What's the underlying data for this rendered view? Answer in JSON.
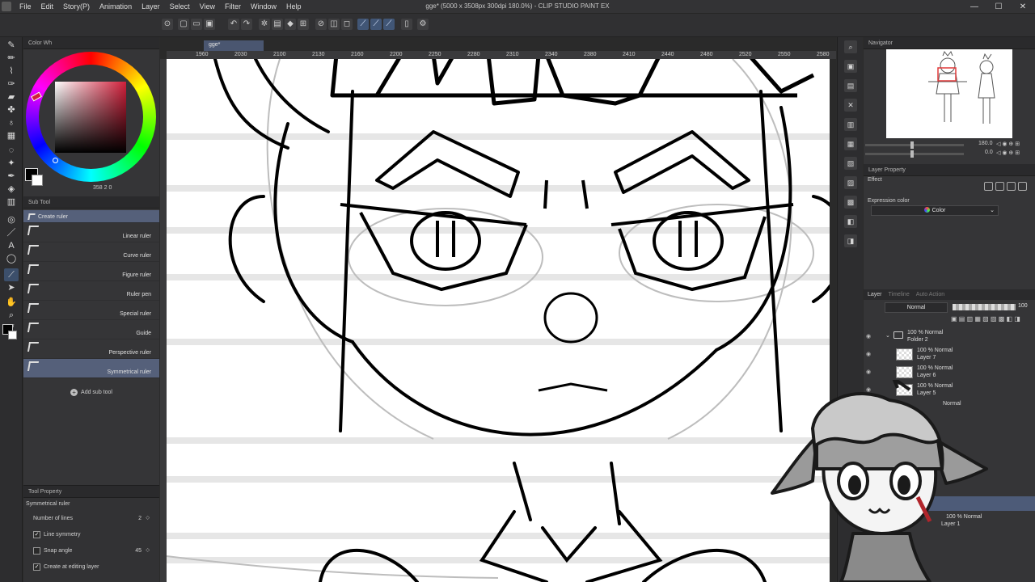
{
  "window": {
    "title": "gge* (5000 x 3508px 300dpi 180.0%) - CLIP STUDIO PAINT EX",
    "menu": [
      "File",
      "Edit",
      "Story(P)",
      "Animation",
      "Layer",
      "Select",
      "View",
      "Filter",
      "Window",
      "Help"
    ],
    "controls": {
      "minimize": "—",
      "maximize": "☐",
      "close": "✕"
    }
  },
  "color_panel": {
    "tab": "Color Wh",
    "readout": "358  2  0",
    "main_color": "#000000",
    "sub_color": "#ffffff",
    "hue_color": "#d11f3a"
  },
  "subtool_panel": {
    "tab": "Sub Tool",
    "items": [
      {
        "label": "Create ruler",
        "selected": true
      },
      {
        "label": "Linear ruler"
      },
      {
        "label": "Curve ruler"
      },
      {
        "label": "Figure ruler"
      },
      {
        "label": "Ruler pen"
      },
      {
        "label": "Special ruler"
      },
      {
        "label": "Guide"
      },
      {
        "label": "Perspective ruler"
      },
      {
        "label": "Symmetrical ruler",
        "selected": true
      }
    ],
    "add_label": "Add sub tool"
  },
  "tool_property": {
    "tab": "Tool Property",
    "title": "Symmetrical ruler",
    "rows": [
      {
        "label": "Number of lines",
        "value": "2"
      },
      {
        "label": "Line symmetry",
        "checked": true
      },
      {
        "label": "Snap angle",
        "value": "45",
        "checked": false
      },
      {
        "label": "Create at editing layer",
        "checked": true
      }
    ]
  },
  "canvas": {
    "tab": "gge*",
    "ruler_numbers": [
      "1960",
      "2030",
      "2100",
      "2130",
      "2160",
      "2200",
      "2250",
      "2280",
      "2310",
      "2340",
      "2380",
      "2410",
      "2440",
      "2480",
      "2520",
      "2550",
      "2580"
    ]
  },
  "navigator": {
    "tab": "Navigator",
    "zoom": "180.0",
    "rotate": "0.0"
  },
  "layer_property": {
    "tab": "Layer Property",
    "effect_label": "Effect",
    "expression_label": "Expression color",
    "expression_value": "Color"
  },
  "layer_panel": {
    "tabs": [
      "Layer",
      "Timeline",
      "Auto Action"
    ],
    "blend_mode": "Normal",
    "opacity": "100",
    "layers": [
      {
        "percent": "100 % Normal",
        "name": "Folder 2",
        "type": "folder"
      },
      {
        "percent": "100 % Normal",
        "name": "Layer 7"
      },
      {
        "percent": "100 % Normal",
        "name": "Layer 6"
      },
      {
        "percent": "100 % Normal",
        "name": "Layer 5"
      },
      {
        "percent": "Normal",
        "name": ""
      },
      {
        "percent": "100 % Normal",
        "name": "Layer 1",
        "selected": true
      }
    ]
  }
}
